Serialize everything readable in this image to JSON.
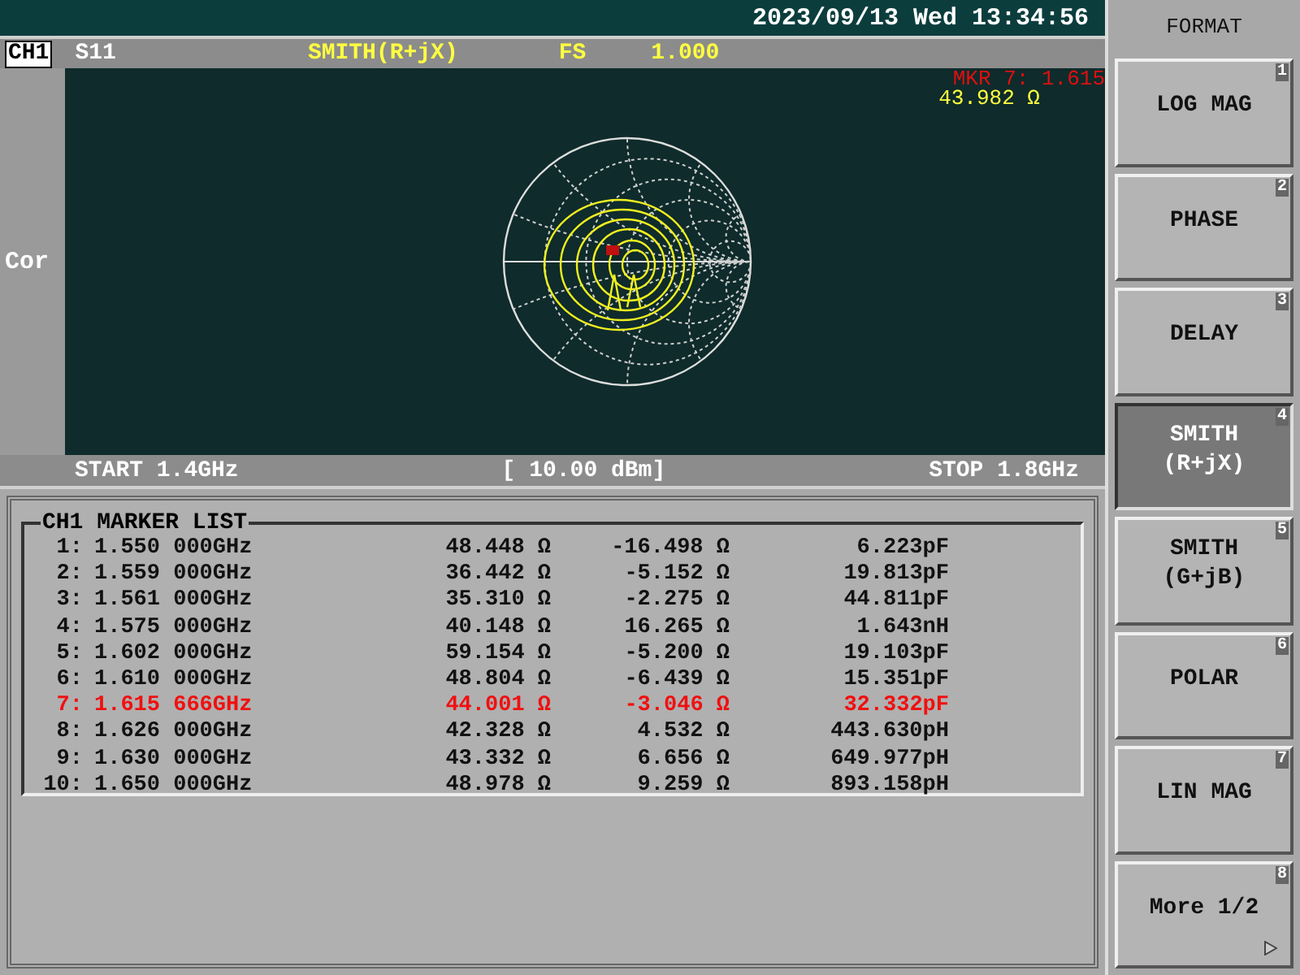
{
  "header": {
    "datetime": "2023/09/13 Wed 13:34:56"
  },
  "channel_bar": {
    "channel": "CH1",
    "parameter": "S11",
    "format": "SMITH(R+jX)",
    "scale_label": "FS",
    "scale_value": "1.000"
  },
  "side_label": "Cor",
  "marker_readout": {
    "marker": "MKR 7: 1.615",
    "value": "43.982 Ω"
  },
  "sweep_bar": {
    "start": "START 1.4GHz",
    "power": "[ 10.00 dBm]",
    "stop": "STOP 1.8GHz"
  },
  "marker_list": {
    "title": "CH1 MARKER LIST",
    "rows": [
      {
        "index": "1:",
        "frequency": "1.550 000GHz",
        "resistance": "48.448 Ω",
        "reactance": "-16.498 Ω",
        "equivalent": "6.223pF",
        "selected": false
      },
      {
        "index": "2:",
        "frequency": "1.559 000GHz",
        "resistance": "36.442 Ω",
        "reactance": "-5.152 Ω",
        "equivalent": "19.813pF",
        "selected": false
      },
      {
        "index": "3:",
        "frequency": "1.561 000GHz",
        "resistance": "35.310 Ω",
        "reactance": "-2.275 Ω",
        "equivalent": "44.811pF",
        "selected": false
      },
      {
        "index": "4:",
        "frequency": "1.575 000GHz",
        "resistance": "40.148 Ω",
        "reactance": "16.265 Ω",
        "equivalent": "1.643nH",
        "selected": false
      },
      {
        "index": "5:",
        "frequency": "1.602 000GHz",
        "resistance": "59.154 Ω",
        "reactance": "-5.200 Ω",
        "equivalent": "19.103pF",
        "selected": false
      },
      {
        "index": "6:",
        "frequency": "1.610 000GHz",
        "resistance": "48.804 Ω",
        "reactance": "-6.439 Ω",
        "equivalent": "15.351pF",
        "selected": false
      },
      {
        "index": "7:",
        "frequency": "1.615 666GHz",
        "resistance": "44.001 Ω",
        "reactance": "-3.046 Ω",
        "equivalent": "32.332pF",
        "selected": true
      },
      {
        "index": "8:",
        "frequency": "1.626 000GHz",
        "resistance": "42.328 Ω",
        "reactance": "4.532 Ω",
        "equivalent": "443.630pH",
        "selected": false
      },
      {
        "index": "9:",
        "frequency": "1.630 000GHz",
        "resistance": "43.332 Ω",
        "reactance": "6.656 Ω",
        "equivalent": "649.977pH",
        "selected": false
      },
      {
        "index": "10:",
        "frequency": "1.650 000GHz",
        "resistance": "48.978 Ω",
        "reactance": "9.259 Ω",
        "equivalent": "893.158pH",
        "selected": false
      }
    ]
  },
  "softkeys": {
    "title": "FORMAT",
    "keys": [
      {
        "label": "LOG MAG",
        "number": "1",
        "kind": "option",
        "selected": false
      },
      {
        "label": "PHASE",
        "number": "2",
        "kind": "option",
        "selected": false
      },
      {
        "label": "DELAY",
        "number": "3",
        "kind": "option",
        "selected": false
      },
      {
        "label": "SMITH\n(R+jX)",
        "number": "4",
        "kind": "option",
        "selected": true
      },
      {
        "label": "SMITH\n(G+jB)",
        "number": "5",
        "kind": "option",
        "selected": false
      },
      {
        "label": "POLAR",
        "number": "6",
        "kind": "option",
        "selected": false
      },
      {
        "label": "LIN MAG",
        "number": "7",
        "kind": "option",
        "selected": false
      },
      {
        "label": "More 1/2",
        "number": "8",
        "kind": "submenu",
        "selected": false
      }
    ]
  }
}
